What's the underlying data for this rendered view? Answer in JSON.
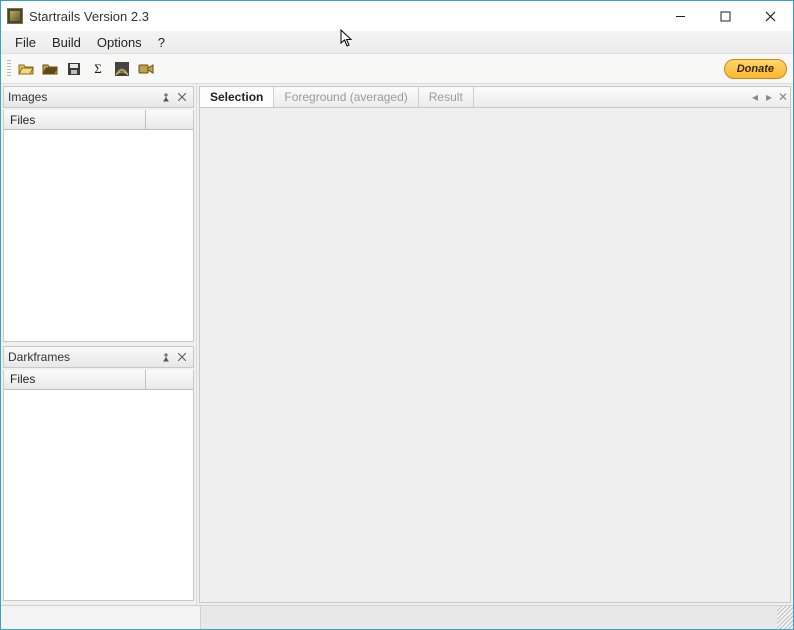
{
  "window": {
    "title": "Startrails Version 2.3"
  },
  "menu": {
    "file": "File",
    "build": "Build",
    "options": "Options",
    "help": "?"
  },
  "toolbar": {
    "donate": "Donate"
  },
  "panels": {
    "images": {
      "title": "Images",
      "column": "Files"
    },
    "darkframes": {
      "title": "Darkframes",
      "column": "Files"
    }
  },
  "tabs": {
    "selection": "Selection",
    "foreground": "Foreground (averaged)",
    "result": "Result"
  }
}
